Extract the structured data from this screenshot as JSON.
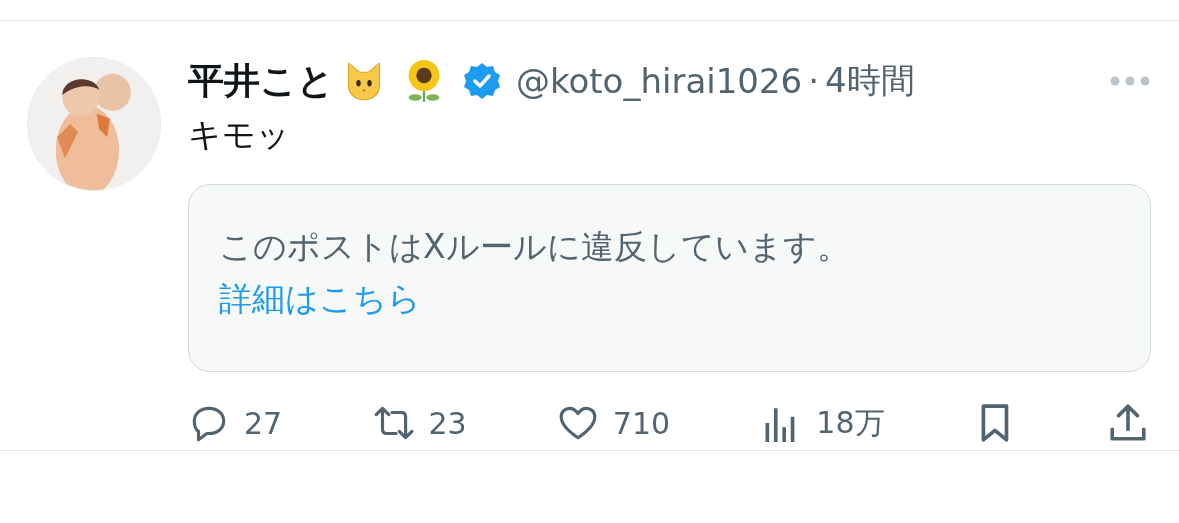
{
  "post": {
    "author": {
      "name": "平井こと",
      "verified": true,
      "handle": "@koto_hirai1026",
      "separator": "·",
      "time": "4時間"
    },
    "text": "キモッ",
    "notice": {
      "text": "このポストはXルールに違反しています。",
      "link": "詳細はこちら"
    },
    "actions": [
      {
        "kind": "reply",
        "count": "27"
      },
      {
        "kind": "repost",
        "count": "23"
      },
      {
        "kind": "like",
        "count": "710"
      },
      {
        "kind": "views",
        "count": "18万"
      },
      {
        "kind": "bookmark"
      },
      {
        "kind": "share"
      }
    ]
  }
}
